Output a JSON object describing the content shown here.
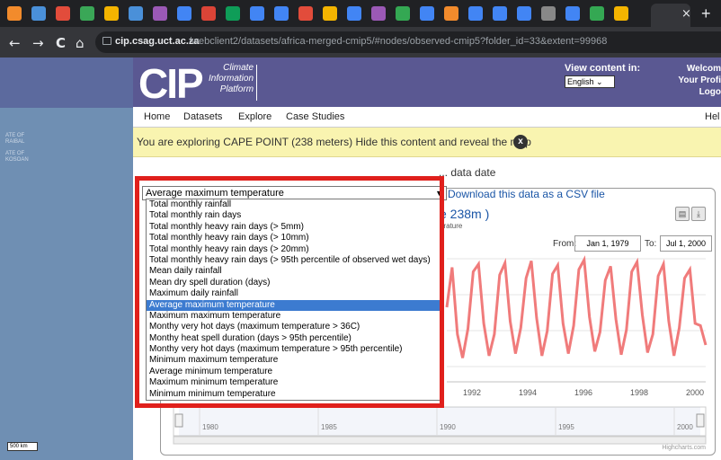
{
  "browser": {
    "tab_close": "×",
    "new_tab": "+",
    "nav": {
      "back": "←",
      "forward": "→",
      "reload": "C",
      "home": "⌂"
    },
    "url_host": "cip.csag.uct.ac.za",
    "url_path": "/webclient2/datasets/africa-merged-cmip5/#nodes/observed-cmip5?folder_id=33&extent=99968",
    "tab_colors": [
      "#f28b2c",
      "#4a90d9",
      "#e24c3b",
      "#3aa757",
      "#f4b400",
      "#4a90d9",
      "#9b59b6",
      "#4285f4",
      "#db4437",
      "#0f9d58",
      "#4285f4",
      "#4285f4",
      "#e24c3b",
      "#f4b400",
      "#4285f4",
      "#9b59b6",
      "#34a853",
      "#4285f4",
      "#f28b2c",
      "#4285f4",
      "#4285f4",
      "#4285f4",
      "#888888",
      "#4285f4",
      "#34a853",
      "#f4b400"
    ]
  },
  "map": {
    "labels": [
      "ATE OF",
      "RAIBAL",
      "ATE OF",
      "KOSOAN"
    ],
    "scale": "500 km"
  },
  "header": {
    "logo": "CIP",
    "logo_sub": [
      "Climate",
      "Information",
      "Platform"
    ],
    "view_content": "View content in:",
    "language": "English",
    "welcome_lines": [
      "Welcom",
      "Your Profi",
      "Logo"
    ]
  },
  "nav": [
    "Home",
    "Datasets",
    "Explore",
    "Case Studies",
    "Hel"
  ],
  "banner": {
    "text": "You are exploring CAPE POINT (238 meters) Hide this content and reveal the map",
    "close": "x"
  },
  "main": {
    "intro": "... data date",
    "selected_variable": "Average maximum temperature",
    "csv_link": "Download this data as a CSV file",
    "chart_title": "e 238m )",
    "chart_subtitle": "erature",
    "from_label": "From:",
    "from_value": "Jan 1, 1979",
    "to_label": "To:",
    "to_value": "Jul 1, 2000",
    "credit": "Highcharts.com"
  },
  "dropdown_options": [
    "Total monthly rainfall",
    "Total monthly rain days",
    "Total monthly heavy rain days (> 5mm)",
    "Total monthly heavy rain days (> 10mm)",
    "Total monthly heavy rain days (> 20mm)",
    "Total monthly heavy rain days (> 95th percentile of observed wet days)",
    "Mean daily rainfall",
    "Mean dry spell duration (days)",
    "Maximum daily rainfall",
    "Average maximum temperature",
    "Maximum maximum temperature",
    "Monthy very hot days (maximum temperature > 36C)",
    "Monthy heat spell duration (days > 95th percentile)",
    "Monthy very hot days (maximum temperature > 95th percentile)",
    "Minimum maximum temperature",
    "Average minimum temperature",
    "Maximum minimum temperature",
    "Minimum minimum temperature"
  ],
  "selected_index": 9,
  "chart_data": {
    "type": "line",
    "x_ticks": [
      "1992",
      "1994",
      "1996",
      "1998",
      "2000"
    ],
    "navigator_ticks": [
      "1980",
      "1985",
      "1990",
      "1995",
      "2000"
    ],
    "series": [
      {
        "values": [
          0.55,
          0.92,
          0.3,
          0.08,
          0.35,
          0.88,
          0.95,
          0.4,
          0.1,
          0.3,
          0.85,
          0.96,
          0.42,
          0.12,
          0.36,
          0.82,
          0.98,
          0.45,
          0.1,
          0.33,
          0.86,
          0.94,
          0.4,
          0.12,
          0.38,
          0.9,
          0.99,
          0.46,
          0.14,
          0.32,
          0.8,
          0.93,
          0.44,
          0.11,
          0.34,
          0.88,
          0.97,
          0.48,
          0.13,
          0.3,
          0.84,
          0.95,
          0.42,
          0.1,
          0.36,
          0.82,
          0.9,
          0.4,
          0.38,
          0.2
        ]
      }
    ],
    "color": "#f07b7b"
  }
}
